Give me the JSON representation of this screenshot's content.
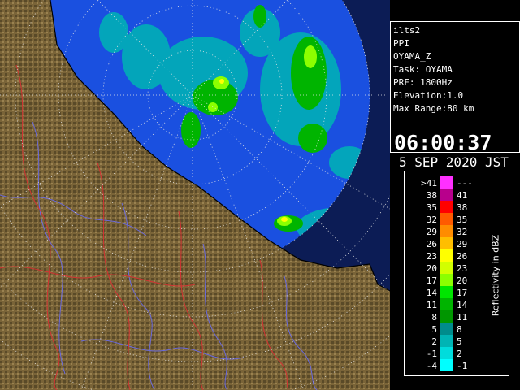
{
  "radar_info": {
    "site_id": "ilts2",
    "product": "PPI",
    "parameter": "OYAMA_Z",
    "task": "Task: OYAMA",
    "prf": "PRF: 1800Hz",
    "elevation": "Elevation:1.0",
    "max_range": "Max Range:80 km",
    "time": "06:00:37",
    "date": "5 SEP 2020 JST"
  },
  "legend": {
    "title": "Reflectivity in dBZ",
    "bins": [
      {
        "low": ">41",
        "high": "---",
        "color": "#ff30ff"
      },
      {
        "low": "38",
        "high": "41",
        "color": "#b8008c"
      },
      {
        "low": "35",
        "high": "38",
        "color": "#ff0000"
      },
      {
        "low": "32",
        "high": "35",
        "color": "#ff5a00"
      },
      {
        "low": "29",
        "high": "32",
        "color": "#ff8c00"
      },
      {
        "low": "26",
        "high": "29",
        "color": "#ffbe00"
      },
      {
        "low": "23",
        "high": "26",
        "color": "#ffff00"
      },
      {
        "low": "20",
        "high": "23",
        "color": "#d2ff00"
      },
      {
        "low": "17",
        "high": "20",
        "color": "#8cff00"
      },
      {
        "low": "14",
        "high": "17",
        "color": "#00e600"
      },
      {
        "low": "11",
        "high": "14",
        "color": "#00b400"
      },
      {
        "low": "8",
        "high": "11",
        "color": "#009600"
      },
      {
        "low": "5",
        "high": "8",
        "color": "#008c8c"
      },
      {
        "low": "2",
        "high": "5",
        "color": "#00b4b4"
      },
      {
        "low": "-1",
        "high": "2",
        "color": "#00dcdc"
      },
      {
        "low": "-4",
        "high": "-1",
        "color": "#00ffff"
      }
    ]
  },
  "colors": {
    "ocean": "#0c1c55",
    "radar_coverage": "#1a50e0",
    "land": "#7a6438",
    "rivers": "#6a6adc",
    "boundaries": "#d23232",
    "range_rings": "#e6e6e6"
  }
}
